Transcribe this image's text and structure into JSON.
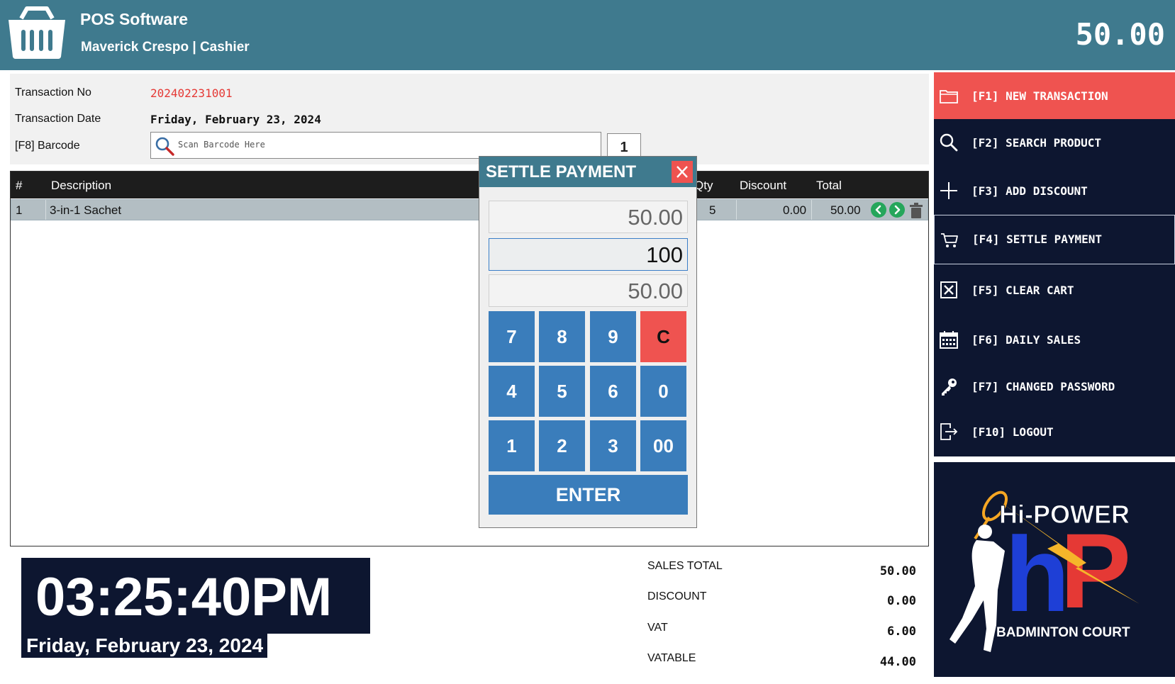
{
  "header": {
    "app_title": "POS Software",
    "user_line": "Maverick Crespo | Cashier",
    "total": "50.00"
  },
  "info": {
    "transaction_no_label": "Transaction No",
    "transaction_no": "202402231001",
    "transaction_date_label": "Transaction Date",
    "transaction_date": "Friday, February 23, 2024",
    "barcode_label": "[F8] Barcode",
    "barcode_placeholder": "Scan Barcode Here",
    "qty": "1"
  },
  "cart": {
    "columns": {
      "num": "#",
      "description": "Description",
      "qty": "Qty",
      "discount": "Discount",
      "total": "Total"
    },
    "rows": [
      {
        "num": "1",
        "description": "3-in-1 Sachet",
        "qty": "5",
        "discount": "0.00",
        "total": "50.00"
      }
    ]
  },
  "clock": {
    "time": "03:25:40PM",
    "date": "Friday, February 23, 2024"
  },
  "summary": {
    "sales_total_label": "SALES TOTAL",
    "sales_total": "50.00",
    "discount_label": "DISCOUNT",
    "discount": "0.00",
    "vat_label": "VAT",
    "vat": "6.00",
    "vatable_label": "VATABLE",
    "vatable": "44.00"
  },
  "menu": {
    "items": [
      {
        "label": "[F1] NEW TRANSACTION",
        "icon": "folder-icon"
      },
      {
        "label": "[F2] SEARCH PRODUCT",
        "icon": "search-icon"
      },
      {
        "label": "[F3] ADD DISCOUNT",
        "icon": "plus-icon"
      },
      {
        "label": "[F4] SETTLE PAYMENT",
        "icon": "cart-icon"
      },
      {
        "label": "[F5] CLEAR CART",
        "icon": "clear-box-icon"
      },
      {
        "label": "[F6] DAILY SALES",
        "icon": "calendar-icon"
      },
      {
        "label": "[F7] CHANGED PASSWORD",
        "icon": "key-icon"
      },
      {
        "label": "[F10] LOGOUT",
        "icon": "logout-icon"
      }
    ]
  },
  "logo": {
    "brand": "Hi-POWER",
    "mark": "hP",
    "tagline": "BADMINTON COURT"
  },
  "dialog": {
    "title": "SETTLE PAYMENT",
    "amount_due": "50.00",
    "tendered": "100",
    "change": "50.00",
    "keys": [
      "7",
      "8",
      "9",
      "C",
      "4",
      "5",
      "6",
      "0",
      "1",
      "2",
      "3",
      "00"
    ],
    "enter_label": "ENTER"
  },
  "colors": {
    "header": "#3f7a8e",
    "navy": "#0d1630",
    "accent_red": "#ef5350",
    "key_blue": "#3a7dbb"
  }
}
